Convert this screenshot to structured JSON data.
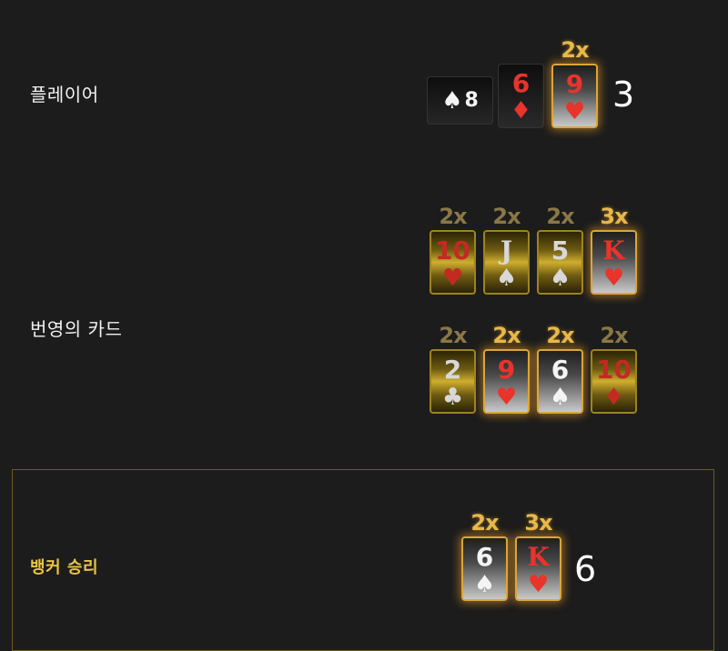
{
  "player": {
    "label": "플레이어",
    "hidden_card": {
      "suit": "♠",
      "rank": "8"
    },
    "cards": [
      {
        "rank": "6",
        "suit": "♦",
        "color": "red",
        "style": "dark",
        "mult": ""
      },
      {
        "rank": "9",
        "suit": "♥",
        "color": "red",
        "style": "silver",
        "mult": "2x"
      }
    ],
    "total": "3"
  },
  "lightning": {
    "label": "번영의 카드",
    "row1": [
      {
        "rank": "10",
        "suit": "♥",
        "color": "red",
        "style": "gold",
        "mult": "2x"
      },
      {
        "rank": "J",
        "suit": "♠",
        "color": "white",
        "style": "gold",
        "mult": "2x"
      },
      {
        "rank": "5",
        "suit": "♠",
        "color": "white",
        "style": "gold",
        "mult": "2x"
      },
      {
        "rank": "K",
        "suit": "♥",
        "color": "red",
        "style": "silver",
        "mult": "3x"
      }
    ],
    "row2": [
      {
        "rank": "2",
        "suit": "♣",
        "color": "white",
        "style": "gold",
        "mult": "2x"
      },
      {
        "rank": "9",
        "suit": "♥",
        "color": "red",
        "style": "silver",
        "mult": "2x"
      },
      {
        "rank": "6",
        "suit": "♠",
        "color": "white",
        "style": "silver",
        "mult": "2x"
      },
      {
        "rank": "10",
        "suit": "♦",
        "color": "red",
        "style": "gold",
        "mult": "2x"
      }
    ]
  },
  "banker": {
    "label": "뱅커 승리",
    "cards": [
      {
        "rank": "6",
        "suit": "♠",
        "color": "white",
        "style": "silver",
        "mult": "2x"
      },
      {
        "rank": "K",
        "suit": "♥",
        "color": "red",
        "style": "silver",
        "mult": "3x"
      }
    ],
    "total": "6"
  }
}
